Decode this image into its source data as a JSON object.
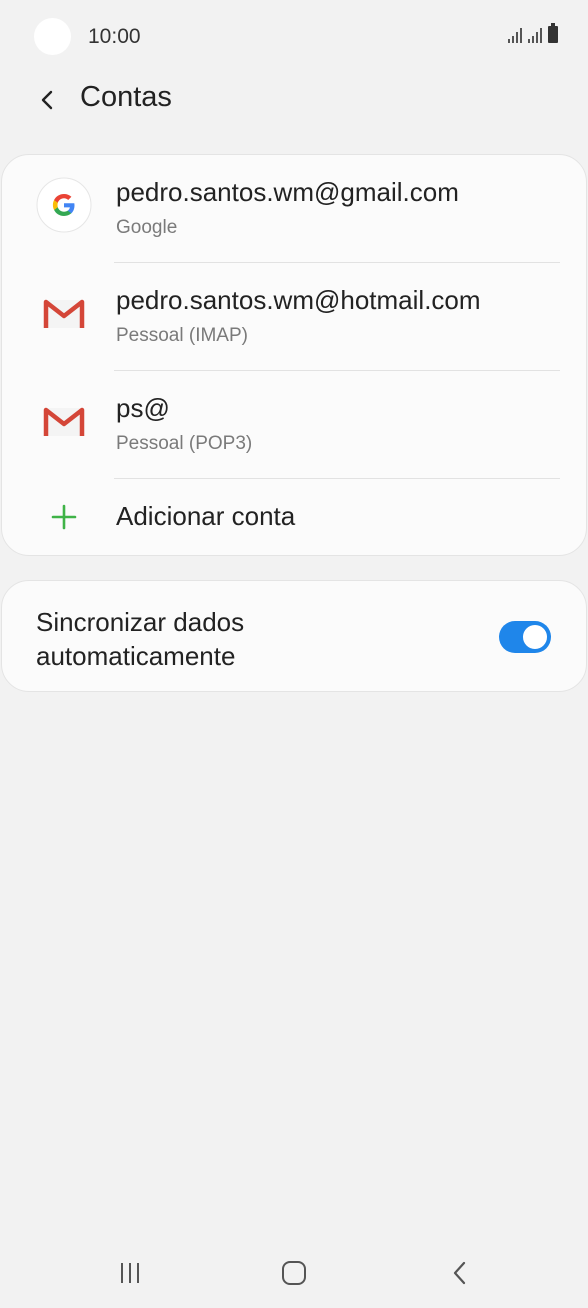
{
  "status_bar": {
    "time": "10:00",
    "icons": [
      "signal-icon",
      "signal-icon",
      "battery-icon"
    ]
  },
  "header": {
    "back_icon": "chevron-left-icon",
    "title": "Contas"
  },
  "accounts": [
    {
      "email": "pedro.santos.wm@gmail.com",
      "type": "Google",
      "icon": "google-logo-icon"
    },
    {
      "email": "pedro.santos.wm@hotmail.com",
      "type": "Pessoal (IMAP)",
      "icon": "gmail-logo-icon"
    },
    {
      "email": "ps@",
      "type": "Pessoal (POP3)",
      "icon": "gmail-logo-icon"
    }
  ],
  "add_account": {
    "label": "Adicionar conta",
    "icon": "plus-icon",
    "icon_color": "#3fb347"
  },
  "sync": {
    "label": "Sincronizar dados automaticamente",
    "enabled": true,
    "toggle_color": "#1f86ea"
  },
  "nav_bar": {
    "buttons": [
      "recents-icon",
      "home-icon",
      "back-icon"
    ]
  }
}
